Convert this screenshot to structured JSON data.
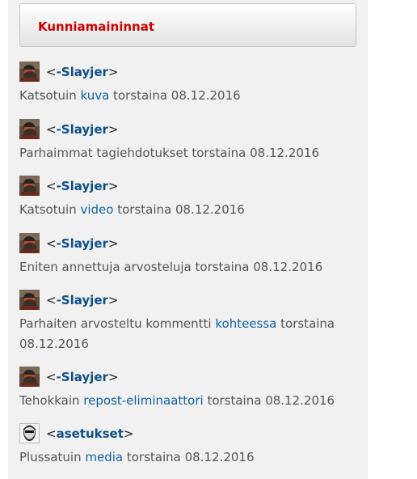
{
  "title": "Kunniamaininnat",
  "entries": [
    {
      "avatar": "helmeted-user-avatar",
      "user": "-Slayjer",
      "prefix": "Katsotuin ",
      "link": "kuva",
      "suffix": " torstaina 08.12.2016"
    },
    {
      "avatar": "helmeted-user-avatar",
      "user": "-Slayjer",
      "prefix": "Parhaimmat tagiehdotukset torstaina 08.12.2016",
      "link": "",
      "suffix": ""
    },
    {
      "avatar": "helmeted-user-avatar",
      "user": "-Slayjer",
      "prefix": "Katsotuin ",
      "link": "video",
      "suffix": " torstaina 08.12.2016"
    },
    {
      "avatar": "helmeted-user-avatar",
      "user": "-Slayjer",
      "prefix": "Eniten annettuja arvosteluja torstaina 08.12.2016",
      "link": "",
      "suffix": ""
    },
    {
      "avatar": "helmeted-user-avatar",
      "user": "-Slayjer",
      "prefix": "Parhaiten arvosteltu kommentti ",
      "link": "kohteessa",
      "suffix": " torstaina 08.12.2016"
    },
    {
      "avatar": "helmeted-user-avatar",
      "user": "-Slayjer",
      "prefix": "Tehokkain ",
      "link": "repost-eliminaattori",
      "suffix": " torstaina 08.12.2016"
    },
    {
      "avatar": "bearded-face-avatar",
      "user": "asetukset",
      "prefix": "Plussatuin ",
      "link": "media",
      "suffix": " torstaina 08.12.2016"
    }
  ]
}
